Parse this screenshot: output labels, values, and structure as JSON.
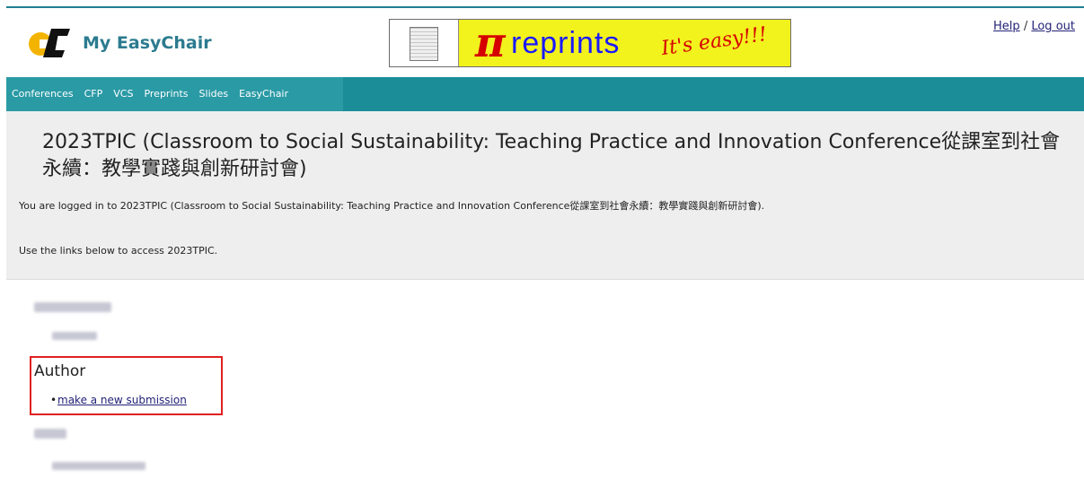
{
  "header": {
    "logo_text": "My EasyChair",
    "banner": {
      "pi": "π",
      "word": "reprints",
      "tagline": "It's easy!!!"
    },
    "links": {
      "help": "Help",
      "separator": "/",
      "logout": "Log out"
    }
  },
  "nav": {
    "items": [
      "Conferences",
      "CFP",
      "VCS",
      "Preprints",
      "Slides",
      "EasyChair"
    ]
  },
  "conference": {
    "title": "2023TPIC (Classroom to Social Sustainability: Teaching Practice and Innovation Conference從課室到社會永續：教學實踐與創新研討會)",
    "logged_in_text": "You are logged in to 2023TPIC (Classroom to Social Sustainability: Teaching Practice and Innovation Conference從課室到社會永續：教學實踐與創新研討會).",
    "use_links_text": "Use the links below to access 2023TPIC."
  },
  "roles": {
    "author": {
      "heading": "Author",
      "link": "make a new submission"
    }
  },
  "colors": {
    "nav_bg": "#1a8d98",
    "brand": "#2c7b8f",
    "link": "#222277",
    "highlight": "#e02020"
  }
}
